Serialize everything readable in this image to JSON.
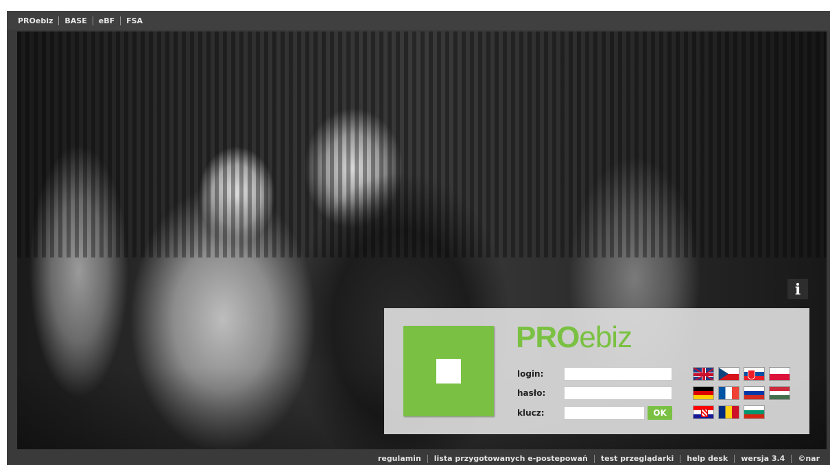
{
  "top_nav": {
    "items": [
      {
        "label": "PROebiz"
      },
      {
        "label": "BASE"
      },
      {
        "label": "eBF"
      },
      {
        "label": "FSA"
      }
    ]
  },
  "info_button": {
    "label": "i",
    "icon": "info-icon"
  },
  "login": {
    "brand_pro": "PRO",
    "brand_ebiz": "ebiz",
    "login_label": "login:",
    "login_value": "",
    "haslo_label": "hasło:",
    "haslo_value": "",
    "klucz_label": "klucz:",
    "klucz_value": "",
    "ok_label": "OK"
  },
  "languages": [
    {
      "code": "gb",
      "icon": "uk-flag-icon"
    },
    {
      "code": "cz",
      "icon": "czech-flag-icon"
    },
    {
      "code": "sk",
      "icon": "slovak-flag-icon"
    },
    {
      "code": "pl",
      "icon": "polish-flag-icon"
    },
    {
      "code": "de",
      "icon": "german-flag-icon"
    },
    {
      "code": "fr",
      "icon": "french-flag-icon"
    },
    {
      "code": "ru",
      "icon": "russian-flag-icon"
    },
    {
      "code": "hu",
      "icon": "hungarian-flag-icon"
    },
    {
      "code": "hr",
      "icon": "croatian-flag-icon"
    },
    {
      "code": "ro",
      "icon": "romanian-flag-icon"
    },
    {
      "code": "bg",
      "icon": "bulgarian-flag-icon"
    }
  ],
  "footer": {
    "links": [
      {
        "label": "regulamin"
      },
      {
        "label": "lista przygotowanych e-postepowań"
      },
      {
        "label": "test przeglądarki"
      },
      {
        "label": "help desk"
      },
      {
        "label": "wersja 3.4"
      },
      {
        "label": "©nar"
      }
    ]
  },
  "colors": {
    "brand_green": "#7ac143",
    "frame_dark": "#3a3a3a"
  }
}
